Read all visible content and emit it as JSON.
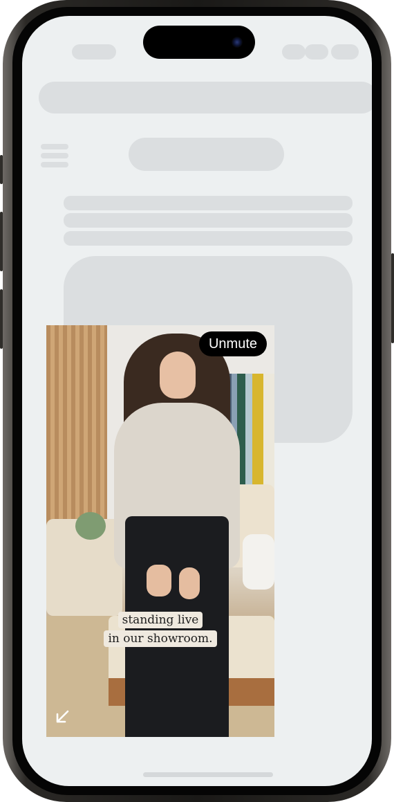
{
  "video": {
    "unmute_label": "Unmute",
    "caption_line1": "standing live",
    "caption_line2": "in our showroom."
  },
  "icons": {
    "collapse": "arrow-down-left-icon",
    "menu": "hamburger-menu-icon"
  },
  "colors": {
    "screen_bg": "#edf0f1",
    "skeleton": "#dbdee0",
    "unmute_bg": "#000000"
  }
}
